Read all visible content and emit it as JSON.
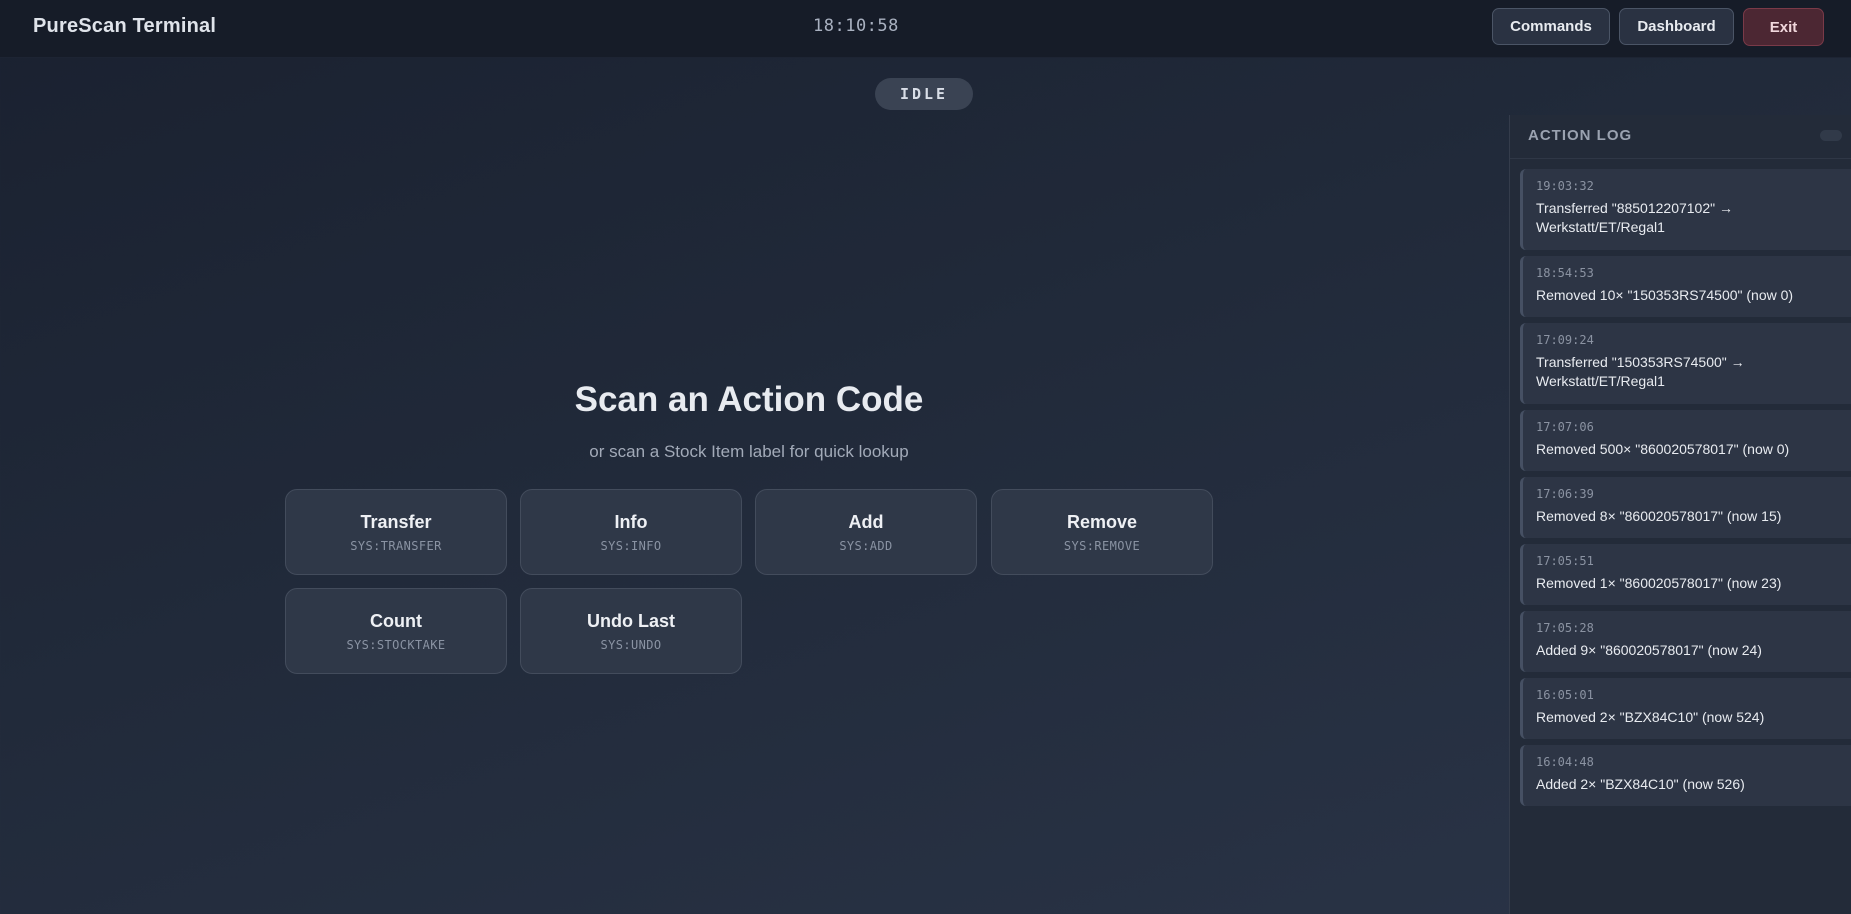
{
  "header": {
    "app_title": "PureScan Terminal",
    "clock": "18:10:58",
    "buttons": {
      "commands": "Commands",
      "dashboard": "Dashboard",
      "exit": "Exit"
    }
  },
  "status": "IDLE",
  "main": {
    "heading": "Scan an Action Code",
    "subheading": "or scan a Stock Item label for quick lookup",
    "actions": [
      {
        "label": "Transfer",
        "code": "SYS:TRANSFER"
      },
      {
        "label": "Info",
        "code": "SYS:INFO"
      },
      {
        "label": "Add",
        "code": "SYS:ADD"
      },
      {
        "label": "Remove",
        "code": "SYS:REMOVE"
      },
      {
        "label": "Count",
        "code": "SYS:STOCKTAKE"
      },
      {
        "label": "Undo Last",
        "code": "SYS:UNDO"
      }
    ]
  },
  "action_log": {
    "title": "ACTION LOG",
    "entries": [
      {
        "time": "19:03:32",
        "message": "Transferred \"885012207102\" → Werkstatt/ET/Regal1"
      },
      {
        "time": "18:54:53",
        "message": "Removed 10× \"150353RS74500\" (now 0)"
      },
      {
        "time": "17:09:24",
        "message": "Transferred \"150353RS74500\" → Werkstatt/ET/Regal1"
      },
      {
        "time": "17:07:06",
        "message": "Removed 500× \"860020578017\" (now 0)"
      },
      {
        "time": "17:06:39",
        "message": "Removed 8× \"860020578017\" (now 15)"
      },
      {
        "time": "17:05:51",
        "message": "Removed 1× \"860020578017\" (now 23)"
      },
      {
        "time": "17:05:28",
        "message": "Added 9× \"860020578017\" (now 24)"
      },
      {
        "time": "16:05:01",
        "message": "Removed 2× \"BZX84C10\" (now 524)"
      },
      {
        "time": "16:04:48",
        "message": "Added 2× \"BZX84C10\" (now 526)"
      }
    ]
  },
  "colors": {
    "background": "#1f2736",
    "exit_accent": "#7a3a48"
  }
}
